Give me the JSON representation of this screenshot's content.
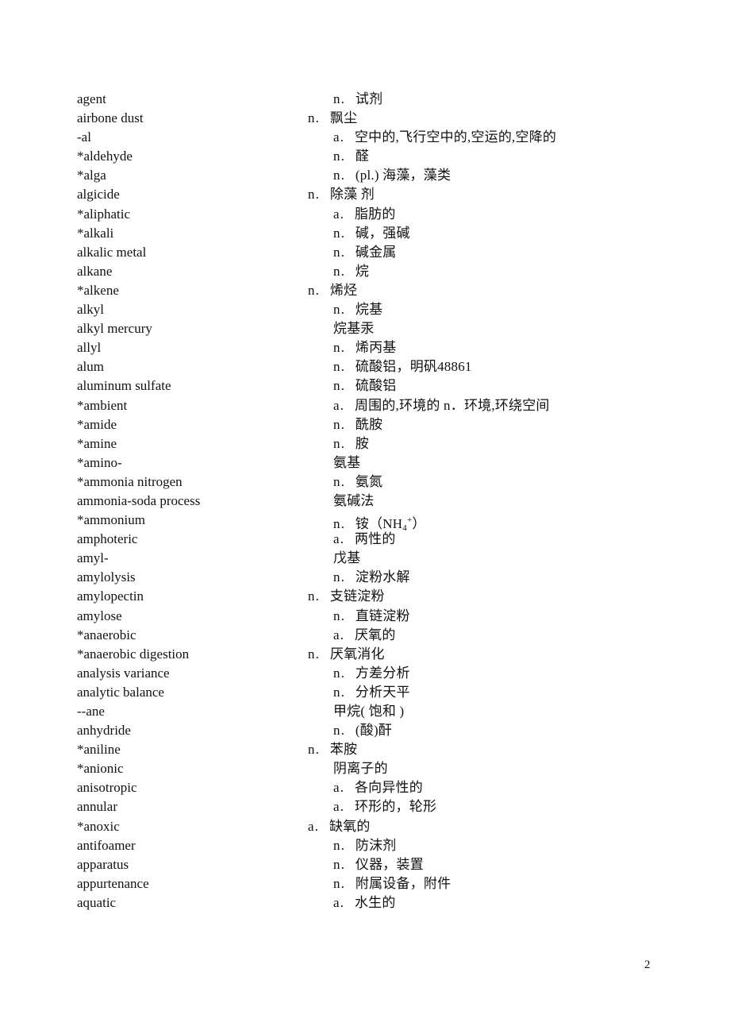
{
  "document": {
    "page_number": "2",
    "entries": [
      {
        "term": "agent",
        "pos": "n",
        "def": "试剂",
        "outdent": false
      },
      {
        "term": "airbone dust",
        "pos": "n",
        "def": "飘尘",
        "outdent": true
      },
      {
        "term": "-al",
        "pos": "a",
        "def": "空中的,飞行空中的,空运的,空降的",
        "outdent": false
      },
      {
        "term": "*aldehyde",
        "pos": "n",
        "def": "醛",
        "outdent": false
      },
      {
        "term": "*alga",
        "pos": "n",
        "def": "(pl.) 海藻，藻类",
        "outdent": false
      },
      {
        "term": "algicide",
        "pos": "n",
        "def": "除藻 剂",
        "outdent": true
      },
      {
        "term": "*aliphatic",
        "pos": "a",
        "def": "脂肪的",
        "outdent": false
      },
      {
        "term": "*alkali",
        "pos": "n",
        "def": "碱，强碱",
        "outdent": false
      },
      {
        "term": "alkalic metal",
        "pos": "n",
        "def": "碱金属",
        "outdent": false
      },
      {
        "term": "alkane",
        "pos": "n",
        "def": "烷",
        "outdent": false
      },
      {
        "term": "*alkene",
        "pos": "n",
        "def": "烯烃",
        "outdent": true
      },
      {
        "term": "alkyl",
        "pos": "n",
        "def": "烷基",
        "outdent": false
      },
      {
        "term": "alkyl mercury",
        "pos": "",
        "def": "烷基汞",
        "outdent": false
      },
      {
        "term": "allyl",
        "pos": "n",
        "def": "烯丙基",
        "outdent": false
      },
      {
        "term": "alum",
        "pos": "n",
        "def": "硫酸铝，明矾48861",
        "outdent": false
      },
      {
        "term": "aluminum sulfate",
        "pos": "n",
        "def": "硫酸铝",
        "outdent": false
      },
      {
        "term": "*ambient",
        "pos": "a",
        "def": "周围的,环境的 n．环境,环绕空间",
        "outdent": false
      },
      {
        "term": "*amide",
        "pos": "n",
        "def": "酰胺",
        "outdent": false
      },
      {
        "term": "*amine",
        "pos": "n",
        "def": "胺",
        "outdent": false
      },
      {
        "term": "*amino-",
        "pos": "",
        "def": "氨基",
        "outdent": false
      },
      {
        "term": "*ammonia nitrogen",
        "pos": "n",
        "def": "氨氮",
        "outdent": false
      },
      {
        "term": "ammonia-soda process",
        "pos": "",
        "def": "氨碱法",
        "outdent": false
      },
      {
        "term": "*ammonium",
        "pos": "n",
        "def": "铵（NH",
        "def_sub": "4",
        "def_sup": "+",
        "def_tail": "）",
        "outdent": false
      },
      {
        "term": "amphoteric",
        "pos": "a",
        "def": "两性的",
        "outdent": false
      },
      {
        "term": "amyl-",
        "pos": "",
        "def": "戊基",
        "outdent": false
      },
      {
        "term": "amylolysis",
        "pos": "n",
        "def": "淀粉水解",
        "outdent": false
      },
      {
        "term": "amylopectin",
        "pos": "n",
        "def": "支链淀粉",
        "outdent": true
      },
      {
        "term": "amylose",
        "pos": "n",
        "def": "直链淀粉",
        "outdent": false
      },
      {
        "term": "*anaerobic",
        "pos": "a",
        "def": "厌氧的",
        "outdent": false
      },
      {
        "term": "*anaerobic digestion",
        "pos": "n",
        "def": "厌氧消化",
        "outdent": true
      },
      {
        "term": "analysis variance",
        "pos": "n",
        "def": "方差分析",
        "outdent": false
      },
      {
        "term": "analytic balance",
        "pos": "n",
        "def": "分析天平",
        "outdent": false
      },
      {
        "term": "--ane",
        "pos": "",
        "def": "甲烷( 饱和 )",
        "outdent": false
      },
      {
        "term": "anhydride",
        "pos": "n",
        "def": "(酸)酐",
        "outdent": false
      },
      {
        "term": "*aniline",
        "pos": "n",
        "def": "苯胺",
        "outdent": true
      },
      {
        "term": "*anionic",
        "pos": "",
        "def": "阴离子的",
        "outdent": false
      },
      {
        "term": "anisotropic",
        "pos": "a",
        "def": "各向异性的",
        "outdent": false
      },
      {
        "term": "annular",
        "pos": "a",
        "def": "环形的，轮形",
        "outdent": false
      },
      {
        "term": "*anoxic",
        "pos": "a",
        "def": "缺氧的",
        "outdent": true
      },
      {
        "term": "antifoamer",
        "pos": "n",
        "def": "防沫剂",
        "outdent": false
      },
      {
        "term": "apparatus",
        "pos": "n",
        "def": "仪器，装置",
        "outdent": false
      },
      {
        "term": "appurtenance",
        "pos": "n",
        "def": "附属设备，附件",
        "outdent": false
      },
      {
        "term": "aquatic",
        "pos": "a",
        "def": "水生的",
        "outdent": false
      }
    ]
  }
}
